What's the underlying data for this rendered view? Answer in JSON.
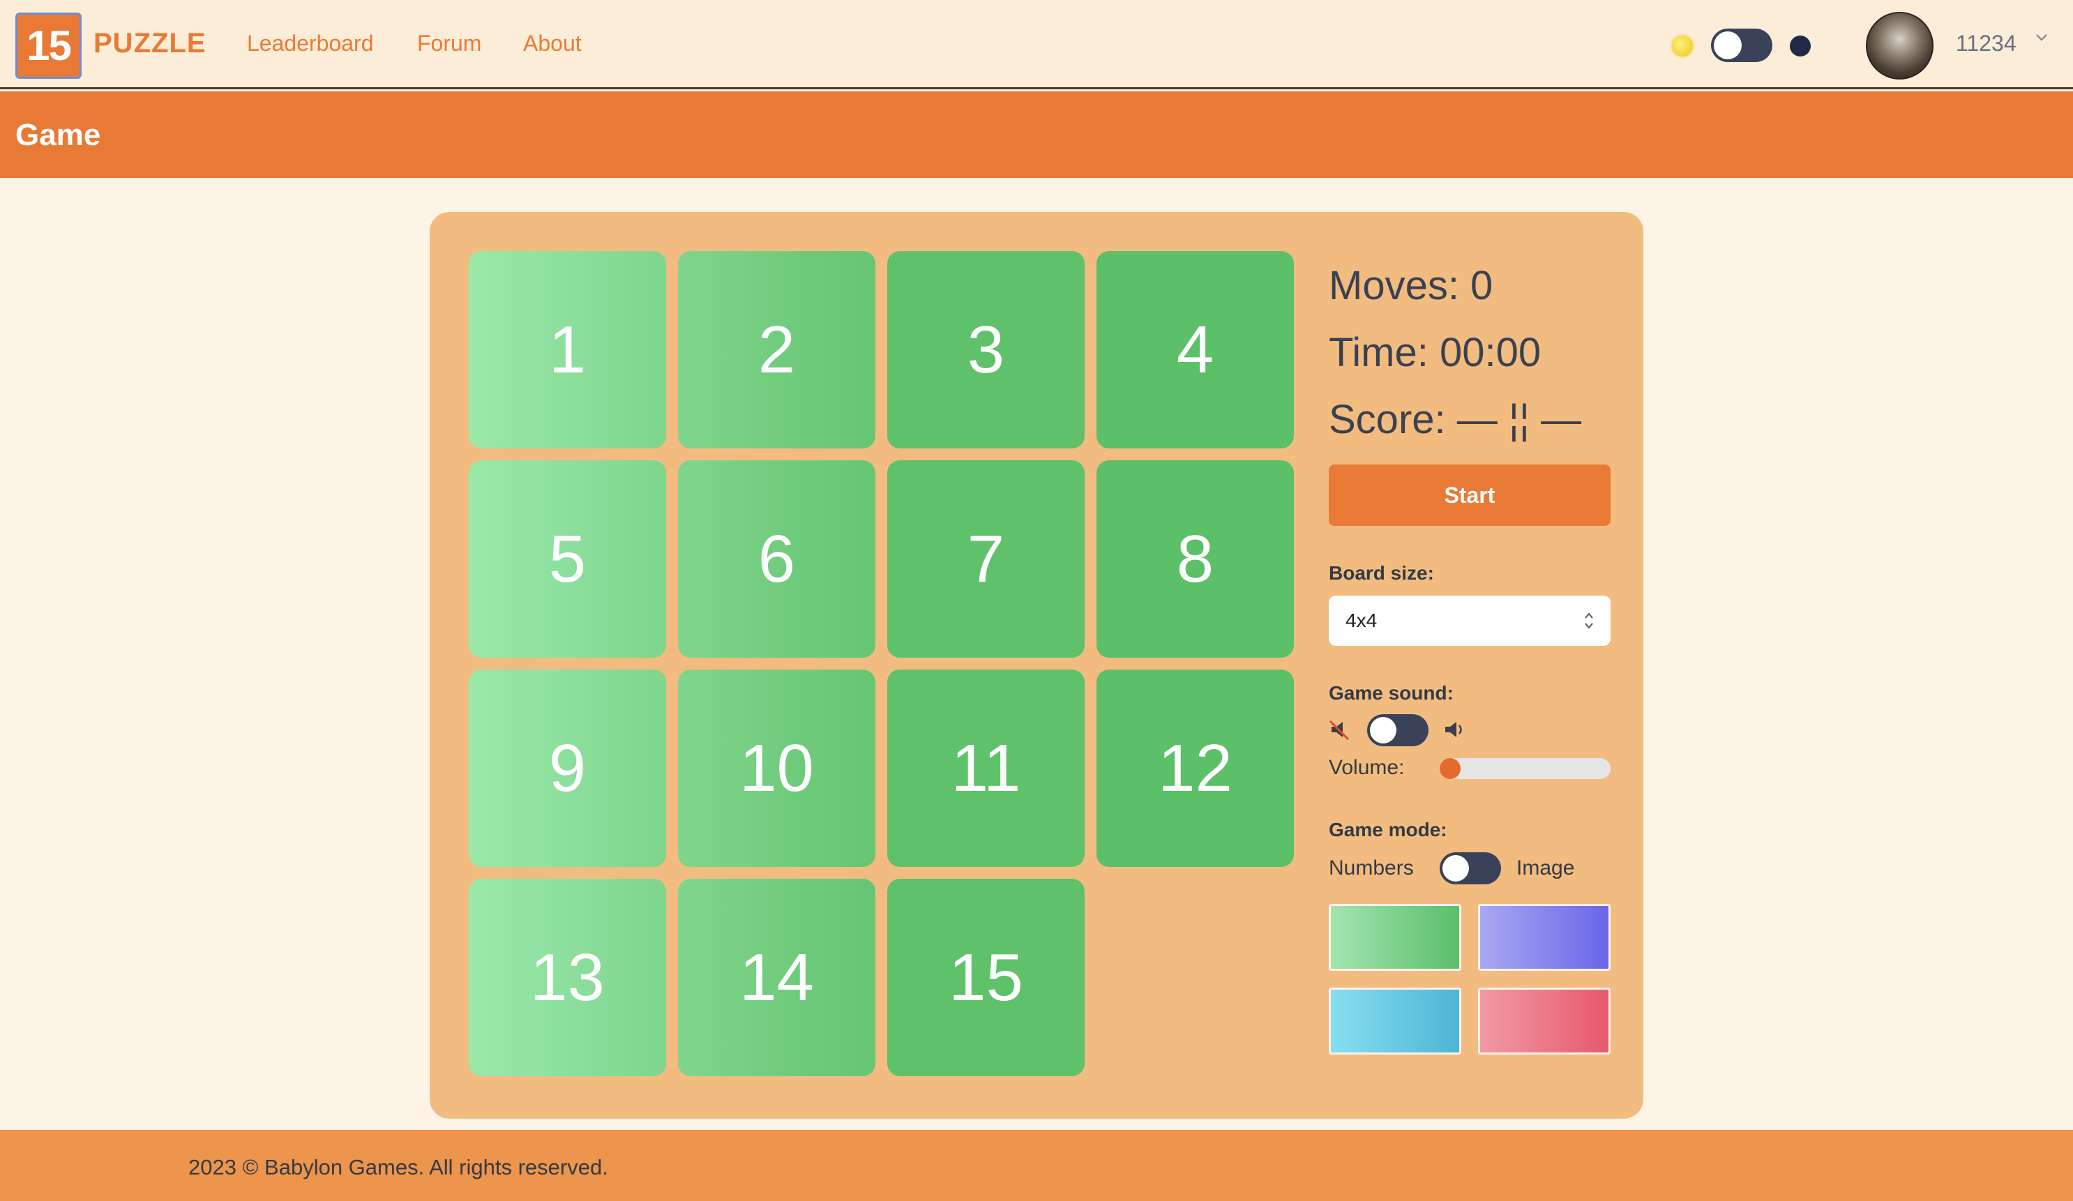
{
  "app": {
    "logo_number": "15",
    "logo_text": "PUZZLE"
  },
  "nav": {
    "links": [
      {
        "label": "Leaderboard"
      },
      {
        "label": "Forum"
      },
      {
        "label": "About"
      }
    ]
  },
  "user": {
    "name": "11234",
    "theme": "light"
  },
  "header": {
    "title": "Game"
  },
  "board": {
    "size": 4,
    "tiles": [
      "1",
      "2",
      "3",
      "4",
      "5",
      "6",
      "7",
      "8",
      "9",
      "10",
      "11",
      "12",
      "13",
      "14",
      "15"
    ],
    "empty_slot": 16,
    "tile_colors": [
      "#9ae9a9",
      "#80d58d",
      "#5fc26b",
      "#5cc068"
    ]
  },
  "stats": {
    "moves": "Moves: 0",
    "time": "Time: 00:00",
    "score": "Score: — ¦¦ —"
  },
  "controls": {
    "start_label": "Start",
    "board_size_label": "Board size:",
    "board_size_value": "4x4",
    "game_sound_label": "Game sound:",
    "game_sound_on": false,
    "volume_label": "Volume:",
    "volume_level": 0,
    "game_mode_label": "Game mode:",
    "mode_left": "Numbers",
    "mode_right": "Image",
    "swatches": [
      {
        "name": "green",
        "from": "#a3e4b0",
        "to": "#5bbf6a"
      },
      {
        "name": "purple",
        "from": "#a9a8f2",
        "to": "#6a66e8"
      },
      {
        "name": "blue",
        "from": "#86dff0",
        "to": "#4fb5d6"
      },
      {
        "name": "red",
        "from": "#f29aa5",
        "to": "#e65a6c"
      }
    ]
  },
  "colors": {
    "accent": "#e97a36",
    "panel": "#f2bc80",
    "background": "#fdf4e6"
  },
  "footer": {
    "text": "2023 © Babylon Games. All rights reserved."
  }
}
